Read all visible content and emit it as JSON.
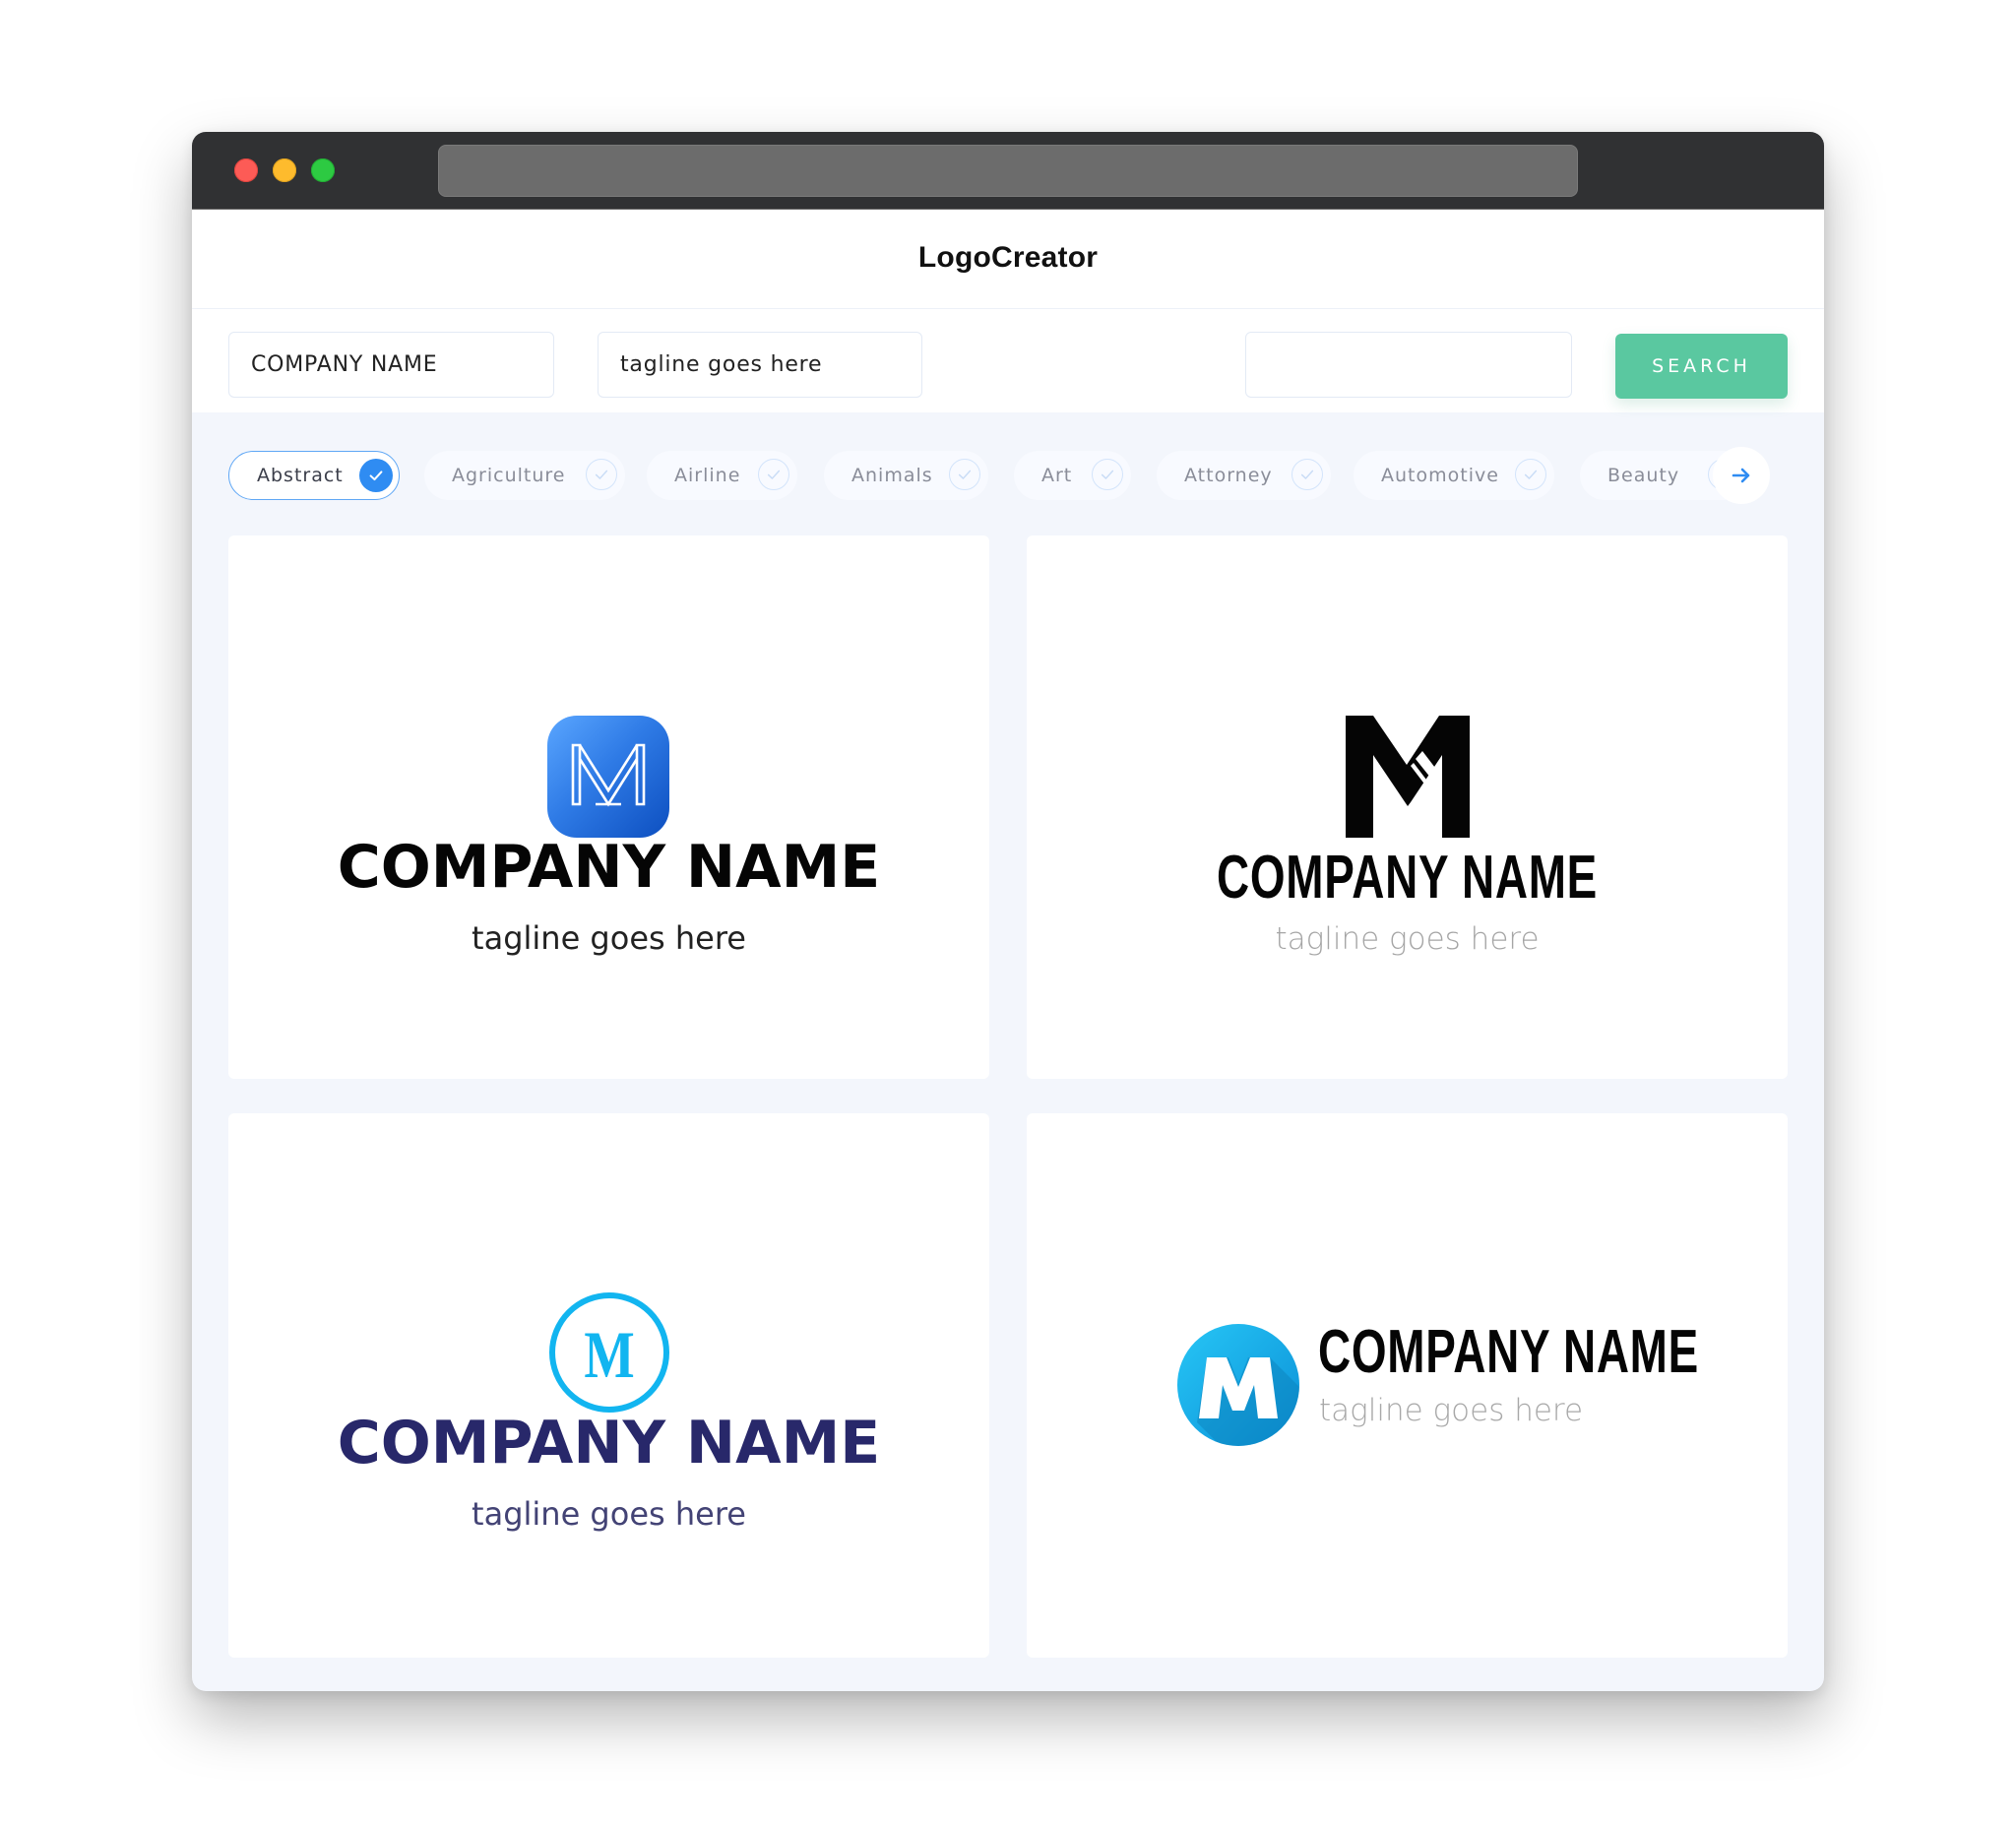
{
  "app": {
    "title": "LogoCreator"
  },
  "window": {
    "controls": [
      "close",
      "minimize",
      "maximize"
    ],
    "colors": {
      "close": "#fd5b56",
      "minimize": "#febb2d",
      "maximize": "#2dca42"
    }
  },
  "search": {
    "company_name_value": "COMPANY NAME",
    "tagline_value": "tagline goes here",
    "keyword_value": "",
    "button_label": "SEARCH",
    "button_color": "#5ac8a0"
  },
  "categories": {
    "items": [
      {
        "label": "Abstract",
        "selected": true
      },
      {
        "label": "Agriculture",
        "selected": false
      },
      {
        "label": "Airline",
        "selected": false
      },
      {
        "label": "Animals",
        "selected": false
      },
      {
        "label": "Art",
        "selected": false
      },
      {
        "label": "Attorney",
        "selected": false
      },
      {
        "label": "Automotive",
        "selected": false
      },
      {
        "label": "Beauty",
        "selected": false
      }
    ],
    "next_icon": "arrow-right-icon",
    "accent": "#2f8cf2"
  },
  "logos": [
    {
      "icon": "rounded-square-m-monogram",
      "icon_letter": "M",
      "company_name": "COMPANY NAME",
      "tagline": "tagline goes here",
      "colors": {
        "icon": "#2f7be6",
        "name": "#050505",
        "tagline": "#222222"
      }
    },
    {
      "icon": "black-m-monogram",
      "icon_letter": "M",
      "company_name": "COMPANY NAME",
      "tagline": "tagline goes here",
      "colors": {
        "icon": "#050505",
        "name": "#050505",
        "tagline": "#a5a5a5"
      }
    },
    {
      "icon": "circle-outline-m-monogram",
      "icon_letter": "M",
      "company_name": "COMPANY NAME",
      "tagline": "tagline goes here",
      "colors": {
        "icon": "#12b5f0",
        "name": "#28286a",
        "tagline": "#434375"
      }
    },
    {
      "icon": "circle-badge-m-monogram",
      "icon_letter": "M",
      "company_name": "COMPANY NAME",
      "tagline": "tagline goes here",
      "colors": {
        "icon": "#1aa6e6",
        "name": "#050505",
        "tagline": "#a8a8a8"
      }
    }
  ]
}
